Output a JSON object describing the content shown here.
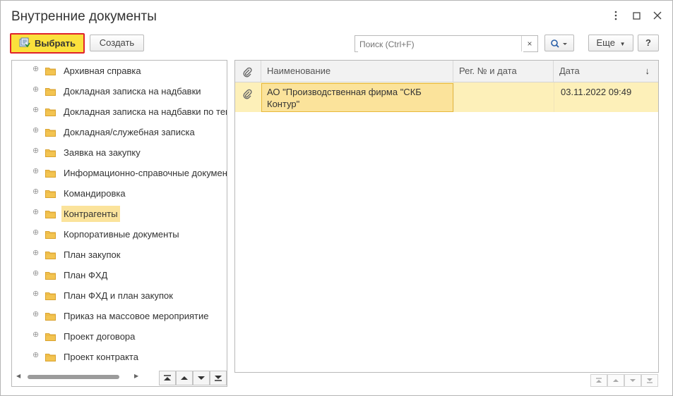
{
  "window": {
    "title": "Внутренние документы"
  },
  "toolbar": {
    "select_label": "Выбрать",
    "create_label": "Создать",
    "search_placeholder": "Поиск (Ctrl+F)",
    "clear_label": "×",
    "more_label": "Еще",
    "help_label": "?"
  },
  "tree": {
    "items": [
      {
        "label": "Архивная справка"
      },
      {
        "label": "Докладная записка на надбавки"
      },
      {
        "label": "Докладная записка на надбавки по тем"
      },
      {
        "label": "Докладная/служебная записка"
      },
      {
        "label": "Заявка на закупку"
      },
      {
        "label": "Информационно-справочные документ"
      },
      {
        "label": "Командировка"
      },
      {
        "label": "Контрагенты",
        "selected": true
      },
      {
        "label": "Корпоративные документы"
      },
      {
        "label": "План закупок"
      },
      {
        "label": "План ФХД"
      },
      {
        "label": "План ФХД и план закупок"
      },
      {
        "label": "Приказ на массовое мероприятие"
      },
      {
        "label": "Проект договора"
      },
      {
        "label": "Проект контракта"
      }
    ]
  },
  "grid": {
    "columns": {
      "name": "Наименование",
      "reg": "Рег. № и дата",
      "date": "Дата",
      "sort_indicator": "↓"
    },
    "rows": [
      {
        "name": "АО \"Производственная фирма \"СКБ Контур\"",
        "reg": "",
        "date": "03.11.2022 09:49"
      }
    ]
  },
  "colors": {
    "accent_button": "#fbe13c",
    "accent_border": "#e0232b",
    "selection": "#fbe39b",
    "row_highlight": "#fdf0b9"
  }
}
